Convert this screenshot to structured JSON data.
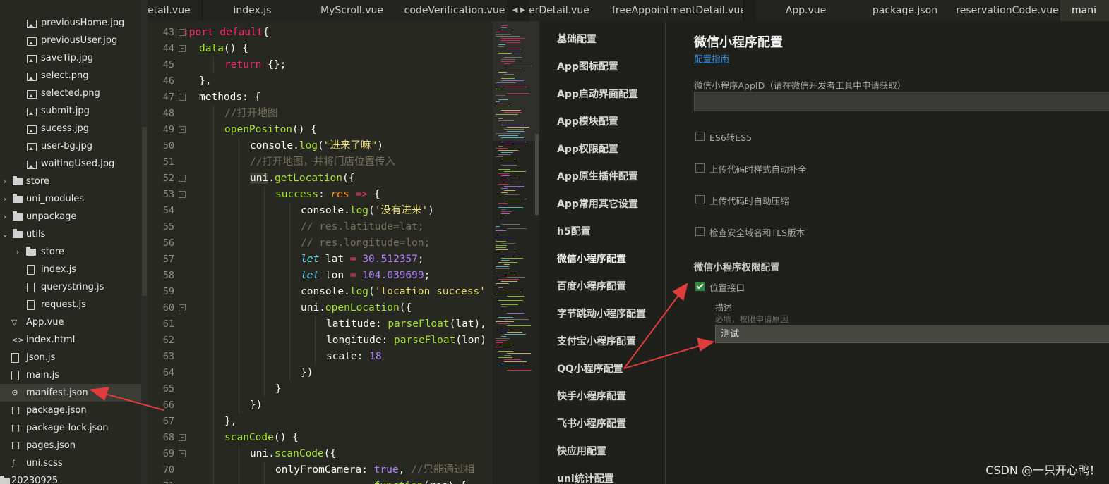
{
  "file_tree": {
    "items": [
      {
        "depth": 2,
        "kind": "image",
        "label": "previousHome.jpg",
        "selected": false
      },
      {
        "depth": 2,
        "kind": "image",
        "label": "previousUser.jpg",
        "selected": false
      },
      {
        "depth": 2,
        "kind": "image",
        "label": "saveTip.jpg",
        "selected": false
      },
      {
        "depth": 2,
        "kind": "image",
        "label": "select.png",
        "selected": false
      },
      {
        "depth": 2,
        "kind": "image",
        "label": "selected.png",
        "selected": false
      },
      {
        "depth": 2,
        "kind": "image",
        "label": "submit.jpg",
        "selected": false
      },
      {
        "depth": 2,
        "kind": "image",
        "label": "sucess.jpg",
        "selected": false
      },
      {
        "depth": 2,
        "kind": "image",
        "label": "user-bg.jpg",
        "selected": false
      },
      {
        "depth": 2,
        "kind": "image",
        "label": "waitingUsed.jpg",
        "selected": false
      },
      {
        "depth": 0,
        "kind": "folder",
        "label": "store",
        "twist": "›",
        "selected": false
      },
      {
        "depth": 0,
        "kind": "folder",
        "label": "uni_modules",
        "twist": "›",
        "selected": false
      },
      {
        "depth": 0,
        "kind": "folder",
        "label": "unpackage",
        "twist": "›",
        "selected": false
      },
      {
        "depth": 0,
        "kind": "folder",
        "label": "utils",
        "twist": "⌄",
        "selected": false
      },
      {
        "depth": 1,
        "kind": "folder",
        "label": "store",
        "twist": "›",
        "selected": false
      },
      {
        "depth": 1,
        "kind": "file",
        "label": "index.js",
        "selected": false
      },
      {
        "depth": 1,
        "kind": "file",
        "label": "querystring.js",
        "selected": false
      },
      {
        "depth": 1,
        "kind": "file",
        "label": "request.js",
        "selected": false
      },
      {
        "depth": 0,
        "kind": "vue",
        "label": "App.vue",
        "selected": false
      },
      {
        "depth": 0,
        "kind": "html",
        "label": "index.html",
        "selected": false
      },
      {
        "depth": 0,
        "kind": "file",
        "label": "Json.js",
        "selected": false
      },
      {
        "depth": 0,
        "kind": "file",
        "label": "main.js",
        "selected": false
      },
      {
        "depth": 0,
        "kind": "manifest",
        "label": "manifest.json",
        "selected": true
      },
      {
        "depth": 0,
        "kind": "json",
        "label": "package.json",
        "selected": false
      },
      {
        "depth": 0,
        "kind": "json",
        "label": "package-lock.json",
        "selected": false
      },
      {
        "depth": 0,
        "kind": "json",
        "label": "pages.json",
        "selected": false
      },
      {
        "depth": 0,
        "kind": "scss",
        "label": "uni.scss",
        "selected": false
      },
      {
        "depth": -1,
        "kind": "root",
        "label": "20230925",
        "twist": "›",
        "selected": false
      }
    ]
  },
  "tabs": [
    {
      "label": "etail.vue",
      "active": false
    },
    {
      "label": "index.js",
      "active": false
    },
    {
      "label": "MyScroll.vue",
      "active": false
    },
    {
      "label": "codeVerification.vue",
      "active": false
    },
    {
      "label": "erDetail.vue",
      "active": false
    },
    {
      "label": "freeAppointmentDetail.vue",
      "active": false
    },
    {
      "label": "App.vue",
      "active": false
    },
    {
      "label": "package.json",
      "active": false
    },
    {
      "label": "reservationCode.vue",
      "active": false
    },
    {
      "label": "mani",
      "active": true
    }
  ],
  "tab_scroll_arrows": "◀ ▶",
  "editor": {
    "lines": [
      {
        "n": "43",
        "fold": true,
        "indent": 0,
        "tokens": [
          [
            "k",
            "‹port default"
          ],
          [
            "",
            "{"
          ]
        ]
      },
      {
        "n": "44",
        "fold": true,
        "indent": 1,
        "tokens": [
          [
            "f",
            "data"
          ],
          [
            "",
            "() {"
          ]
        ]
      },
      {
        "n": "45",
        "fold": false,
        "indent": 2,
        "tokens": [
          [
            "k",
            "return"
          ],
          [
            "",
            " {};"
          ]
        ]
      },
      {
        "n": "46",
        "fold": false,
        "indent": 1,
        "tokens": [
          [
            "",
            "},"
          ]
        ]
      },
      {
        "n": "47",
        "fold": true,
        "indent": 1,
        "tokens": [
          [
            "",
            "methods: {"
          ]
        ]
      },
      {
        "n": "48",
        "fold": false,
        "indent": 2,
        "tokens": [
          [
            "c",
            "//打开地图"
          ]
        ]
      },
      {
        "n": "49",
        "fold": true,
        "indent": 2,
        "tokens": [
          [
            "f",
            "openPositon"
          ],
          [
            "",
            "() {"
          ]
        ]
      },
      {
        "n": "50",
        "fold": false,
        "indent": 3,
        "tokens": [
          [
            "",
            "console."
          ],
          [
            "f",
            "log"
          ],
          [
            "",
            "("
          ],
          [
            "s",
            "\"进来了嘛\""
          ],
          [
            "",
            ")"
          ]
        ]
      },
      {
        "n": "51",
        "fold": false,
        "indent": 3,
        "tokens": [
          [
            "c",
            "//打开地图，并将门店位置传入"
          ]
        ]
      },
      {
        "n": "52",
        "fold": true,
        "indent": 3,
        "tokens": [
          [
            "hl",
            "uni"
          ],
          [
            "",
            "."
          ],
          [
            "f",
            "getLocation"
          ],
          [
            "",
            "({"
          ]
        ]
      },
      {
        "n": "53",
        "fold": true,
        "indent": 4,
        "tokens": [
          [
            "f",
            "success"
          ],
          [
            "",
            ": "
          ],
          [
            "pa",
            "res"
          ],
          [
            "",
            " "
          ],
          [
            "k",
            "=>"
          ],
          [
            "",
            " {"
          ]
        ]
      },
      {
        "n": "54",
        "fold": false,
        "indent": 5,
        "tokens": [
          [
            "",
            "console."
          ],
          [
            "f",
            "log"
          ],
          [
            "",
            "("
          ],
          [
            "s",
            "'没有进来'"
          ],
          [
            "",
            ")"
          ]
        ]
      },
      {
        "n": "55",
        "fold": false,
        "indent": 5,
        "tokens": [
          [
            "c",
            "// res.latitude=lat;"
          ]
        ]
      },
      {
        "n": "56",
        "fold": false,
        "indent": 5,
        "tokens": [
          [
            "c",
            "// res.longitude=lon;"
          ]
        ]
      },
      {
        "n": "57",
        "fold": false,
        "indent": 5,
        "tokens": [
          [
            "it",
            "let"
          ],
          [
            "",
            " lat "
          ],
          [
            "k",
            "="
          ],
          [
            "",
            " "
          ],
          [
            "n",
            "30.512357"
          ],
          [
            "",
            ";"
          ]
        ]
      },
      {
        "n": "58",
        "fold": false,
        "indent": 5,
        "tokens": [
          [
            "it",
            "let"
          ],
          [
            "",
            " lon "
          ],
          [
            "k",
            "="
          ],
          [
            "",
            " "
          ],
          [
            "n",
            "104.039699"
          ],
          [
            "",
            ";"
          ]
        ]
      },
      {
        "n": "59",
        "fold": false,
        "indent": 5,
        "tokens": [
          [
            "",
            "console."
          ],
          [
            "f",
            "log"
          ],
          [
            "",
            "("
          ],
          [
            "s",
            "'location success'"
          ]
        ]
      },
      {
        "n": "60",
        "fold": true,
        "indent": 5,
        "tokens": [
          [
            "",
            "uni."
          ],
          [
            "f",
            "openLocation"
          ],
          [
            "",
            "({"
          ]
        ]
      },
      {
        "n": "61",
        "fold": false,
        "indent": 6,
        "tokens": [
          [
            "",
            "latitude: "
          ],
          [
            "f",
            "parseFloat"
          ],
          [
            "",
            "(lat),"
          ]
        ]
      },
      {
        "n": "62",
        "fold": false,
        "indent": 6,
        "tokens": [
          [
            "",
            "longitude: "
          ],
          [
            "f",
            "parseFloat"
          ],
          [
            "",
            "(lon)"
          ]
        ]
      },
      {
        "n": "63",
        "fold": false,
        "indent": 6,
        "tokens": [
          [
            "",
            "scale: "
          ],
          [
            "n",
            "18"
          ]
        ]
      },
      {
        "n": "64",
        "fold": false,
        "indent": 5,
        "tokens": [
          [
            "",
            "})"
          ]
        ]
      },
      {
        "n": "65",
        "fold": false,
        "indent": 4,
        "tokens": [
          [
            "",
            "}"
          ]
        ]
      },
      {
        "n": "66",
        "fold": false,
        "indent": 3,
        "tokens": [
          [
            "",
            "})"
          ]
        ]
      },
      {
        "n": "67",
        "fold": false,
        "indent": 2,
        "tokens": [
          [
            "",
            "},"
          ]
        ]
      },
      {
        "n": "68",
        "fold": true,
        "indent": 2,
        "tokens": [
          [
            "f",
            "scanCode"
          ],
          [
            "",
            "() {"
          ]
        ]
      },
      {
        "n": "69",
        "fold": true,
        "indent": 3,
        "tokens": [
          [
            "",
            "uni."
          ],
          [
            "f",
            "scanCode"
          ],
          [
            "",
            "({"
          ]
        ]
      },
      {
        "n": "70",
        "fold": false,
        "indent": 4,
        "tokens": [
          [
            "",
            "onlyFromCamera: "
          ],
          [
            "n",
            "true"
          ],
          [
            "",
            ", "
          ],
          [
            "c",
            "//只能通过相"
          ]
        ]
      },
      {
        "n": "71",
        "fold": false,
        "indent": 4,
        "tokens": [
          [
            "",
            "  "
          ],
          [
            "f",
            "              function"
          ],
          [
            "",
            "(res) {"
          ]
        ]
      }
    ]
  },
  "settings_nav": {
    "items": [
      {
        "label": "基础配置",
        "active": false
      },
      {
        "label": "App图标配置",
        "active": false
      },
      {
        "label": "App启动界面配置",
        "active": false
      },
      {
        "label": "App模块配置",
        "active": false
      },
      {
        "label": "App权限配置",
        "active": false
      },
      {
        "label": "App原生插件配置",
        "active": false
      },
      {
        "label": "App常用其它设置",
        "active": false
      },
      {
        "label": "h5配置",
        "active": false
      },
      {
        "label": "微信小程序配置",
        "active": true
      },
      {
        "label": "百度小程序配置",
        "active": false
      },
      {
        "label": "字节跳动小程序配置",
        "active": false
      },
      {
        "label": "支付宝小程序配置",
        "active": false
      },
      {
        "label": "QQ小程序配置",
        "active": false
      },
      {
        "label": "快手小程序配置",
        "active": false
      },
      {
        "label": "飞书小程序配置",
        "active": false
      },
      {
        "label": "快应用配置",
        "active": false
      },
      {
        "label": "uni统计配置",
        "active": false
      }
    ]
  },
  "settings_panel": {
    "title": "微信小程序配置",
    "guide_link": "配置指南",
    "appid_label": "微信小程序AppID（请在微信开发者工具中申请获取）",
    "appid_value": "",
    "checkboxes": [
      {
        "label": "ES6转ES5",
        "checked": false
      },
      {
        "label": "上传代码时样式自动补全",
        "checked": false
      },
      {
        "label": "上传代码时自动压缩",
        "checked": false
      },
      {
        "label": "检查安全域名和TLS版本",
        "checked": false
      }
    ],
    "permission_section": "微信小程序权限配置",
    "location_permission": {
      "label": "位置接口",
      "checked": true
    },
    "desc_label": "描述",
    "desc_hint": "必填，权限申请原因",
    "desc_value": "测试"
  },
  "watermark": "CSDN @一只开心鸭！",
  "colors": {
    "annotation_arrow": "#e03c3c",
    "checkbox_checked": "#2d8a3a",
    "link": "#3d8fd6"
  }
}
